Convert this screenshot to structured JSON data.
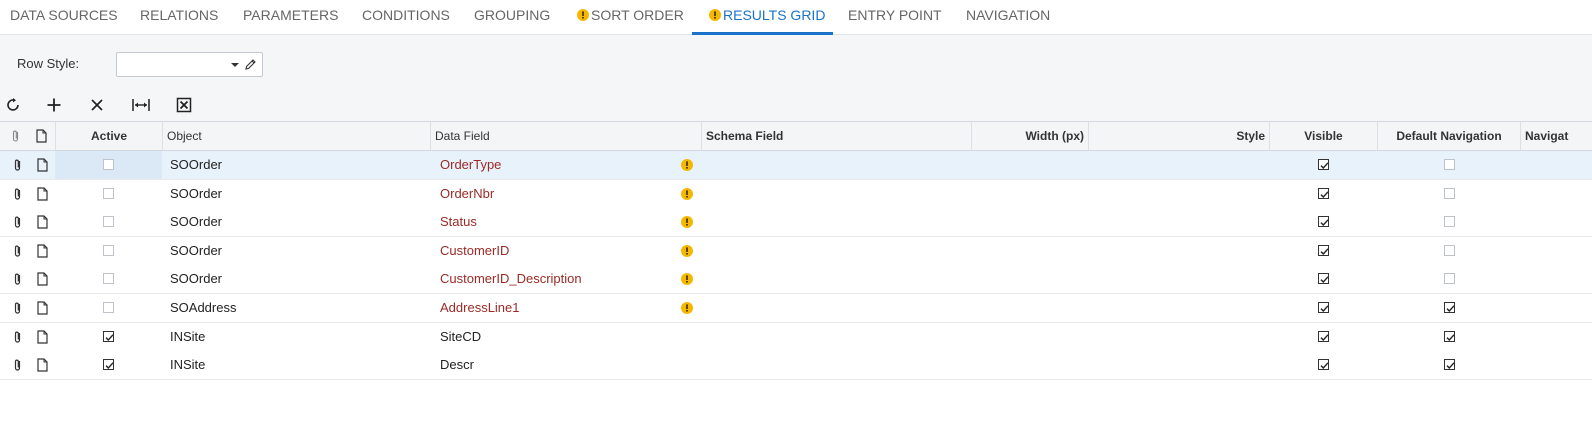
{
  "tabs": [
    {
      "label": "DATA SOURCES",
      "warning": false,
      "active": false
    },
    {
      "label": "RELATIONS",
      "warning": false,
      "active": false
    },
    {
      "label": "PARAMETERS",
      "warning": false,
      "active": false
    },
    {
      "label": "CONDITIONS",
      "warning": false,
      "active": false
    },
    {
      "label": "GROUPING",
      "warning": false,
      "active": false
    },
    {
      "label": "SORT ORDER",
      "warning": true,
      "active": false
    },
    {
      "label": "RESULTS GRID",
      "warning": true,
      "active": true
    },
    {
      "label": "ENTRY POINT",
      "warning": false,
      "active": false
    },
    {
      "label": "NAVIGATION",
      "warning": false,
      "active": false
    }
  ],
  "form": {
    "row_style_label": "Row Style:",
    "row_style_value": ""
  },
  "toolbar": [
    "refresh-icon",
    "add-icon",
    "delete-icon",
    "fit-width-icon",
    "excel-export-icon"
  ],
  "grid": {
    "headers": {
      "active": "Active",
      "object": "Object",
      "data_field": "Data Field",
      "schema_field": "Schema Field",
      "width": "Width (px)",
      "style": "Style",
      "visible": "Visible",
      "default_navigation": "Default Navigation",
      "navigation": "Navigat"
    },
    "rows": [
      {
        "active": false,
        "object": "SOOrder",
        "data_field": "OrderType",
        "error": true,
        "schema_field": "",
        "width": "",
        "style": "",
        "visible": true,
        "default_navigation": false,
        "selected": true
      },
      {
        "active": false,
        "object": "SOOrder",
        "data_field": "OrderNbr",
        "error": true,
        "schema_field": "",
        "width": "",
        "style": "",
        "visible": true,
        "default_navigation": false,
        "selected": false
      },
      {
        "active": false,
        "object": "SOOrder",
        "data_field": "Status",
        "error": true,
        "schema_field": "",
        "width": "",
        "style": "",
        "visible": true,
        "default_navigation": false,
        "selected": false
      },
      {
        "active": false,
        "object": "SOOrder",
        "data_field": "CustomerID",
        "error": true,
        "schema_field": "",
        "width": "",
        "style": "",
        "visible": true,
        "default_navigation": false,
        "selected": false
      },
      {
        "active": false,
        "object": "SOOrder",
        "data_field": "CustomerID_Description",
        "error": true,
        "schema_field": "",
        "width": "",
        "style": "",
        "visible": true,
        "default_navigation": false,
        "selected": false
      },
      {
        "active": false,
        "object": "SOAddress",
        "data_field": "AddressLine1",
        "error": true,
        "schema_field": "",
        "width": "",
        "style": "",
        "visible": true,
        "default_navigation": true,
        "selected": false
      },
      {
        "active": true,
        "object": "INSite",
        "data_field": "SiteCD",
        "error": false,
        "schema_field": "",
        "width": "",
        "style": "",
        "visible": true,
        "default_navigation": true,
        "selected": false
      },
      {
        "active": true,
        "object": "INSite",
        "data_field": "Descr",
        "error": false,
        "schema_field": "",
        "width": "",
        "style": "",
        "visible": true,
        "default_navigation": true,
        "selected": false
      }
    ]
  },
  "colors": {
    "accent": "#1a73c9",
    "warning": "#f5b800",
    "error_text": "#9b2a26",
    "selected_row": "#e8f2fb"
  }
}
